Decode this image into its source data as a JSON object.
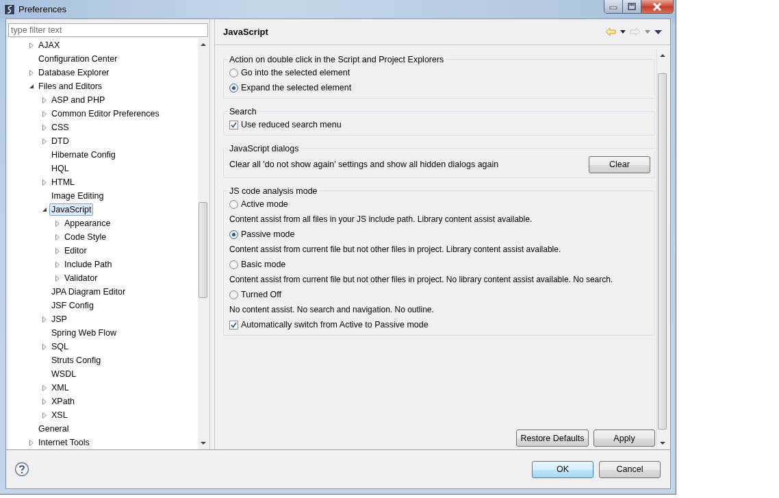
{
  "window": {
    "title": "Preferences"
  },
  "filter": {
    "placeholder": "type filter text"
  },
  "tree": [
    {
      "label": "AJAX",
      "kind": "branch",
      "expanded": false,
      "selected": false
    },
    {
      "label": "Configuration Center",
      "kind": "leaf",
      "selected": false
    },
    {
      "label": "Database Explorer",
      "kind": "branch",
      "expanded": false,
      "selected": false
    },
    {
      "label": "Files and Editors",
      "kind": "branch",
      "expanded": true,
      "selected": false,
      "children": [
        {
          "label": "ASP and PHP",
          "kind": "branch",
          "expanded": false,
          "selected": false
        },
        {
          "label": "Common Editor Preferences",
          "kind": "branch",
          "expanded": false,
          "selected": false
        },
        {
          "label": "CSS",
          "kind": "branch",
          "expanded": false,
          "selected": false
        },
        {
          "label": "DTD",
          "kind": "branch",
          "expanded": false,
          "selected": false
        },
        {
          "label": "Hibernate Config",
          "kind": "leaf",
          "selected": false
        },
        {
          "label": "HQL",
          "kind": "leaf",
          "selected": false
        },
        {
          "label": "HTML",
          "kind": "branch",
          "expanded": false,
          "selected": false
        },
        {
          "label": "Image Editing",
          "kind": "leaf",
          "selected": false
        },
        {
          "label": "JavaScript",
          "kind": "branch",
          "expanded": true,
          "selected": true,
          "children": [
            {
              "label": "Appearance",
              "kind": "branch",
              "expanded": false,
              "selected": false
            },
            {
              "label": "Code Style",
              "kind": "branch",
              "expanded": false,
              "selected": false
            },
            {
              "label": "Editor",
              "kind": "branch",
              "expanded": false,
              "selected": false
            },
            {
              "label": "Include Path",
              "kind": "branch",
              "expanded": false,
              "selected": false
            },
            {
              "label": "Validator",
              "kind": "branch",
              "expanded": false,
              "selected": false
            }
          ]
        },
        {
          "label": "JPA Diagram Editor",
          "kind": "leaf",
          "selected": false
        },
        {
          "label": "JSF Config",
          "kind": "leaf",
          "selected": false
        },
        {
          "label": "JSP",
          "kind": "branch",
          "expanded": false,
          "selected": false
        },
        {
          "label": "Spring Web Flow",
          "kind": "leaf",
          "selected": false
        },
        {
          "label": "SQL",
          "kind": "branch",
          "expanded": false,
          "selected": false
        },
        {
          "label": "Struts Config",
          "kind": "leaf",
          "selected": false
        },
        {
          "label": "WSDL",
          "kind": "leaf",
          "selected": false
        },
        {
          "label": "XML",
          "kind": "branch",
          "expanded": false,
          "selected": false
        },
        {
          "label": "XPath",
          "kind": "branch",
          "expanded": false,
          "selected": false
        },
        {
          "label": "XSL",
          "kind": "branch",
          "expanded": false,
          "selected": false
        }
      ]
    },
    {
      "label": "General",
      "kind": "leaf",
      "selected": false
    },
    {
      "label": "Internet Tools",
      "kind": "branch",
      "expanded": false,
      "selected": false
    }
  ],
  "page": {
    "title": "JavaScript",
    "forward_disabled": true
  },
  "sections": [
    {
      "title": "Action on double click in the Script and Project Explorers",
      "items": [
        {
          "kind": "radio",
          "label": "Go into the selected element",
          "selected": false
        },
        {
          "kind": "radio",
          "label": "Expand the selected element",
          "selected": true
        }
      ]
    },
    {
      "title": "Search",
      "items": [
        {
          "kind": "checkbox",
          "label": "Use reduced search menu",
          "checked": true
        }
      ]
    },
    {
      "title": "JavaScript dialogs",
      "items": [
        {
          "kind": "action",
          "label": "Clear all 'do not show again' settings and show all hidden dialogs again",
          "button": "Clear"
        }
      ]
    },
    {
      "title": "JS code analysis mode",
      "items": [
        {
          "kind": "radio",
          "label": "Active mode",
          "selected": false
        },
        {
          "kind": "note",
          "label": "Content assist from all files in your JS include path. Library content assist available."
        },
        {
          "kind": "radio",
          "label": "Passive mode",
          "selected": true
        },
        {
          "kind": "note",
          "label": "Content assist from current file but not other files in project. Library content assist available."
        },
        {
          "kind": "radio",
          "label": "Basic mode",
          "selected": false
        },
        {
          "kind": "note",
          "label": "Content assist from current file but not other files in project. No library content assist available. No search."
        },
        {
          "kind": "radio",
          "label": "Turned Off",
          "selected": false
        },
        {
          "kind": "note",
          "label": "No content assist. No search and navigation. No outline."
        },
        {
          "kind": "checkbox",
          "label": "Automatically switch from Active to Passive mode",
          "checked": true
        }
      ]
    }
  ],
  "page_buttons": [
    "Restore Defaults",
    "Apply"
  ],
  "dialog_buttons": [
    {
      "label": "OK",
      "default": true
    },
    {
      "label": "Cancel",
      "default": false
    }
  ]
}
